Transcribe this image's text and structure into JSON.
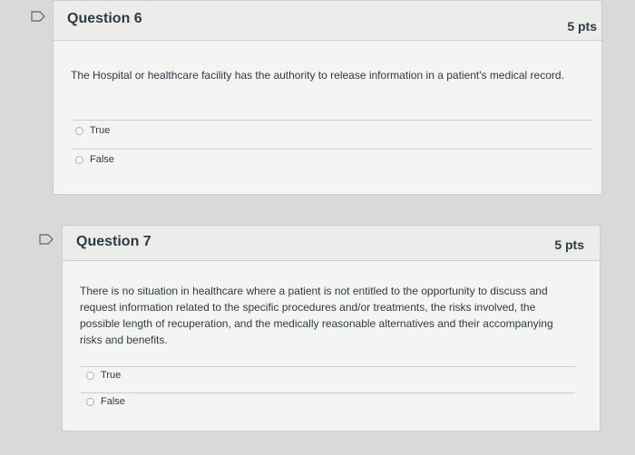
{
  "questions": [
    {
      "title": "Question 6",
      "points": "5 pts",
      "text": "The Hospital or healthcare facility has the authority to release information in a patient's medical record.",
      "answers": [
        "True",
        "False"
      ]
    },
    {
      "title": "Question 7",
      "points": "5 pts",
      "text": "There is no situation in healthcare where a patient is not entitled to the opportunity to discuss and request information related to the specific procedures and/or treatments, the risks involved, the possible length of recuperation, and the medically reasonable alternatives and their accompanying risks and benefits.",
      "answers": [
        "True",
        "False"
      ]
    }
  ]
}
